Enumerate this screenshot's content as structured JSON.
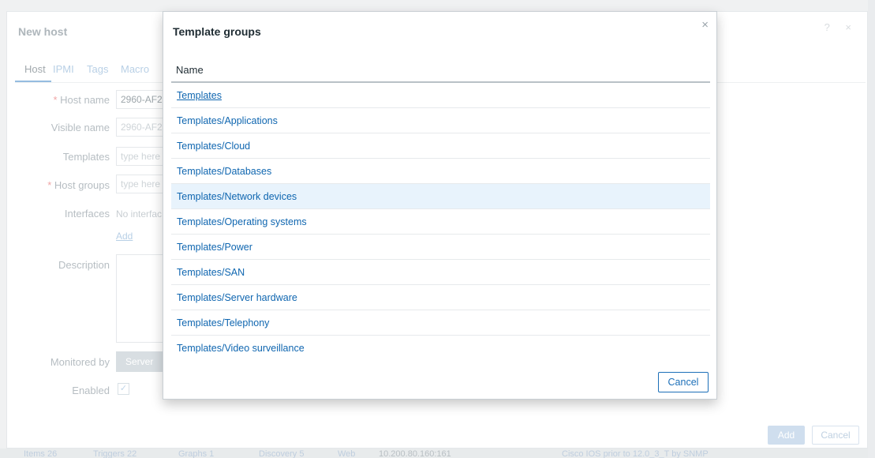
{
  "background_strip": [
    "Items 26",
    "Triggers 22",
    "Graphs 1",
    "Discovery 5",
    "Web",
    "10.200.80.160:161",
    "Cisco IOS prior to 12.0_3_T by SNMP"
  ],
  "host_dialog": {
    "title": "New host",
    "icons": "? ×",
    "tabs": [
      "Host",
      "IPMI",
      "Tags",
      "Macro"
    ],
    "fields": {
      "host_name": {
        "label": "Host name",
        "value": "2960-AF2"
      },
      "visible_name": {
        "label": "Visible name",
        "placeholder": "2960-AF2"
      },
      "templates": {
        "label": "Templates",
        "placeholder": "type here"
      },
      "host_groups": {
        "label": "Host groups",
        "placeholder": "type here"
      },
      "interfaces": {
        "label": "Interfaces",
        "value": "No interfac",
        "add_link": "Add"
      },
      "description": {
        "label": "Description"
      },
      "monitored_by": {
        "label": "Monitored by",
        "value": "Server"
      },
      "enabled": {
        "label": "Enabled",
        "checked": true
      }
    },
    "required_mark": "*",
    "check_glyph": "✓",
    "buttons": {
      "add": "Add",
      "cancel": "Cancel"
    }
  },
  "modal": {
    "title": "Template groups",
    "close_icon": "×",
    "column_header": "Name",
    "rows": [
      "Templates",
      "Templates/Applications",
      "Templates/Cloud",
      "Templates/Databases",
      "Templates/Network devices",
      "Templates/Operating systems",
      "Templates/Power",
      "Templates/SAN",
      "Templates/Server hardware",
      "Templates/Telephony",
      "Templates/Video surveillance"
    ],
    "hovered_row": "Templates/Network devices",
    "cancel_label": "Cancel"
  },
  "colors": {
    "link": "#0f66b0",
    "hover_row": "#e8f3fc",
    "accent": "#1c6fb8"
  }
}
